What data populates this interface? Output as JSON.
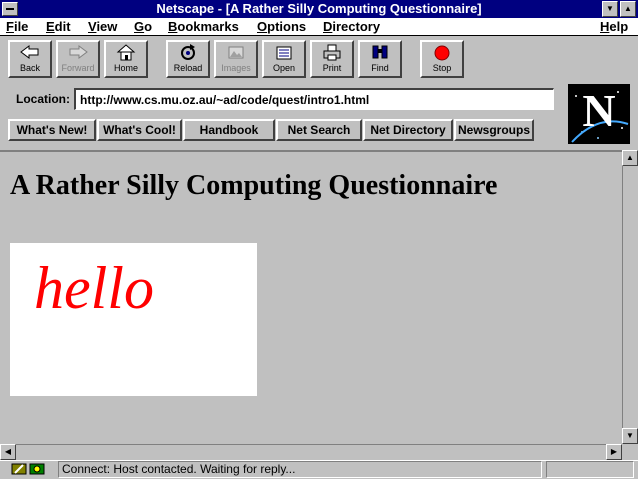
{
  "window": {
    "title": "Netscape - [A Rather Silly Computing Questionnaire]"
  },
  "menu": {
    "items": [
      "File",
      "Edit",
      "View",
      "Go",
      "Bookmarks",
      "Options",
      "Directory"
    ],
    "help": "Help"
  },
  "toolbar": {
    "buttons": [
      {
        "label": "Back",
        "icon": "back-arrow-icon",
        "enabled": true
      },
      {
        "label": "Forward",
        "icon": "forward-arrow-icon",
        "enabled": false
      },
      {
        "label": "Home",
        "icon": "home-icon",
        "enabled": true
      },
      {
        "label": "Reload",
        "icon": "reload-icon",
        "enabled": true
      },
      {
        "label": "Images",
        "icon": "images-icon",
        "enabled": false
      },
      {
        "label": "Open",
        "icon": "open-icon",
        "enabled": true
      },
      {
        "label": "Print",
        "icon": "print-icon",
        "enabled": true
      },
      {
        "label": "Find",
        "icon": "find-binoculars-icon",
        "enabled": true
      },
      {
        "label": "Stop",
        "icon": "stop-icon",
        "enabled": true
      }
    ]
  },
  "location": {
    "label": "Location:",
    "url": "http://www.cs.mu.oz.au/~ad/code/quest/intro1.html"
  },
  "directory_buttons": [
    "What's New!",
    "What's Cool!",
    "Handbook",
    "Net Search",
    "Net Directory",
    "Newsgroups"
  ],
  "logo": {
    "letter": "N"
  },
  "page": {
    "heading": "A Rather Silly Computing Questionnaire",
    "image_text": "hello",
    "image_text_color": "#ff0000"
  },
  "status": {
    "text": "Connect: Host contacted. Waiting for reply..."
  },
  "colors": {
    "titlebar": "#000080",
    "chrome": "#c0c0c0",
    "stop_red": "#ff0000"
  }
}
